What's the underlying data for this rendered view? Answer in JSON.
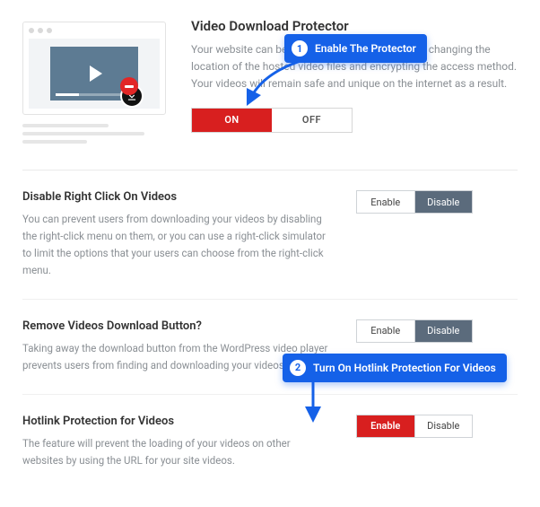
{
  "hero": {
    "title": "Video Download Protector",
    "description": "Your website can be protected with this option by changing the location of the hosted video files and encrypting the access method. Your videos will remain safe and unique on the internet as a result.",
    "on_label": "ON",
    "off_label": "OFF"
  },
  "sections": [
    {
      "title": "Disable Right Click On Videos",
      "description": "You can prevent users from downloading your videos by disabling the right-click menu on them, or you can use a right-click simulator to limit the options that your users can choose from the right-click menu.",
      "enable": "Enable",
      "disable": "Disable"
    },
    {
      "title": "Remove Videos Download Button?",
      "description": "Taking away the download button from the WordPress video player prevents users from finding and downloading your videos.",
      "enable": "Enable",
      "disable": "Disable"
    },
    {
      "title": "Hotlink Protection for Videos",
      "description": "The feature will prevent the loading of your videos on other websites by using the URL for your site videos.",
      "enable": "Enable",
      "disable": "Disable"
    }
  ],
  "callouts": {
    "c1_num": "1",
    "c1_text": "Enable The Protector",
    "c2_num": "2",
    "c2_text": "Turn On Hotlink Protection For Videos"
  }
}
